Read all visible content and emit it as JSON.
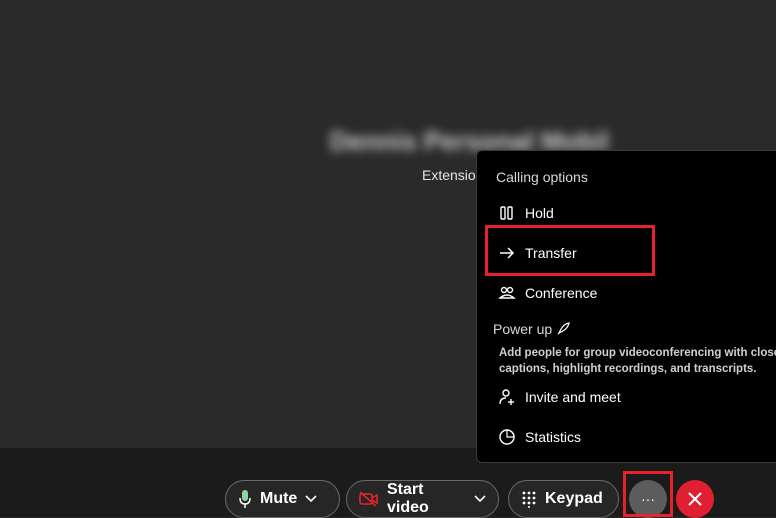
{
  "call": {
    "caller_name": "Dennis Personal Mobile",
    "caller_sub": "Extension"
  },
  "controls": {
    "mute_label": "Mute",
    "video_label": "Start video",
    "keypad_label": "Keypad",
    "more_label": "···"
  },
  "menu": {
    "heading": "Calling options",
    "items": [
      {
        "label": "Hold",
        "icon": "pause-icon"
      },
      {
        "label": "Transfer",
        "icon": "arrow-right-icon"
      },
      {
        "label": "Conference",
        "icon": "people-icon"
      }
    ],
    "power_up_label": "Power up",
    "power_up_desc_line1": "Add people for group videoconferencing with closed",
    "power_up_desc_line2": "captions, highlight recordings, and transcripts.",
    "extra_items": [
      {
        "label": "Invite and meet",
        "icon": "person-add-icon"
      },
      {
        "label": "Statistics",
        "icon": "statistics-icon"
      }
    ]
  },
  "colors": {
    "background": "#2a2a2a",
    "bar": "#1b1b1b",
    "menu": "#000000",
    "end_call": "#e02030",
    "highlight": "#e8222c",
    "video_off_icon": "#e8222c"
  }
}
